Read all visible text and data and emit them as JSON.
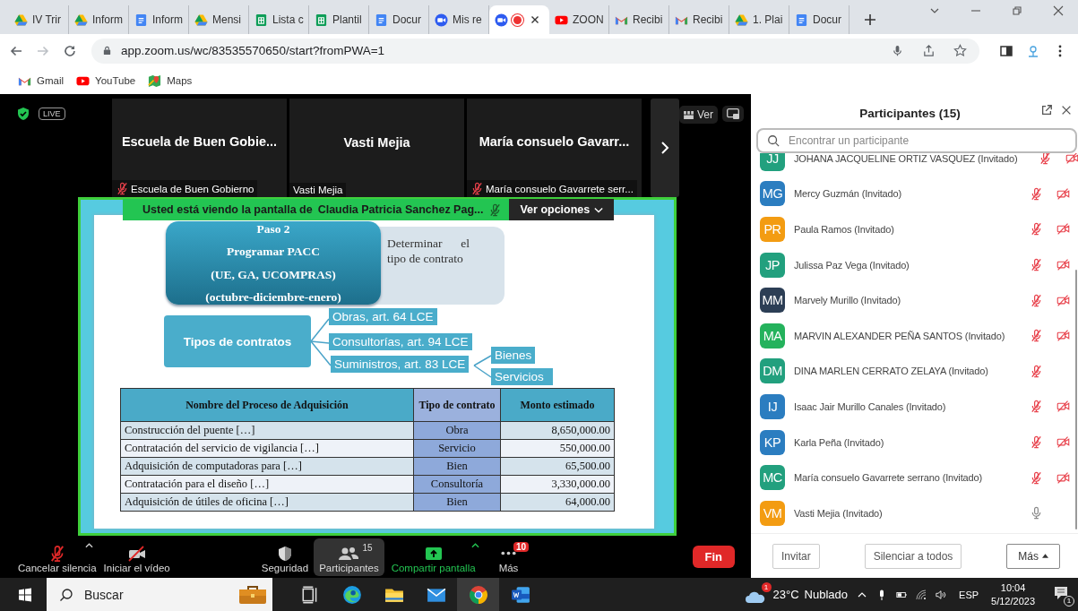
{
  "browser": {
    "tabs": [
      {
        "label": "IV Trir",
        "kind": "drive",
        "selected": false,
        "recording": false
      },
      {
        "label": "Inform",
        "kind": "drive",
        "selected": false,
        "recording": false
      },
      {
        "label": "Inform",
        "kind": "docs",
        "selected": false,
        "recording": false
      },
      {
        "label": "Mensi",
        "kind": "drive",
        "selected": false,
        "recording": false
      },
      {
        "label": "Lista c",
        "kind": "sheets",
        "selected": false,
        "recording": false
      },
      {
        "label": "Plantil",
        "kind": "sheets",
        "selected": false,
        "recording": false
      },
      {
        "label": "Docur",
        "kind": "docs",
        "selected": false,
        "recording": false
      },
      {
        "label": "Mis re",
        "kind": "zoom",
        "selected": false,
        "recording": false
      },
      {
        "kind": "zoom",
        "selected": true,
        "recording": true
      },
      {
        "label": "ZOON",
        "kind": "youtube",
        "selected": false,
        "recording": false
      },
      {
        "label": "Recibi",
        "kind": "gmail",
        "selected": false,
        "recording": false
      },
      {
        "label": "Recibi",
        "kind": "gmail",
        "selected": false,
        "recording": false
      },
      {
        "label": "1. Plai",
        "kind": "drive",
        "selected": false,
        "recording": false
      },
      {
        "label": "Docur",
        "kind": "docs",
        "selected": false,
        "recording": false
      }
    ],
    "url": "app.zoom.us/wc/83535570650/start?fromPWA=1",
    "bookmarks": [
      {
        "label": "Gmail",
        "kind": "gmail"
      },
      {
        "label": "YouTube",
        "kind": "youtube"
      },
      {
        "label": "Maps",
        "kind": "maps"
      }
    ]
  },
  "meeting": {
    "live_label": "LIVE",
    "tiles": [
      {
        "name": "Escuela de Buen Gobie...",
        "label": "Escuela de Buen Gobierno",
        "muted": true
      },
      {
        "name": "Vasti Mejia",
        "label": "Vasti Mejia",
        "muted": false
      },
      {
        "name": "María consuelo Gavarr...",
        "label": "María consuelo Gavarrete serr...",
        "muted": true
      }
    ],
    "view_button": "Ver",
    "banner": {
      "text": "Usted está viendo la pantalla de",
      "presenter": "Claudia Patricia Sanchez Pag...",
      "options": "Ver opciones"
    },
    "slide": {
      "step_lines": [
        "Paso 2",
        "Programar PACC",
        "(UE, GA, UCOMPRAS)",
        "(octubre-diciembre-enero)"
      ],
      "note": "Determinar el tipo de contrato",
      "types_title": "Tipos de contratos",
      "types": [
        {
          "label": "Obras, art. 64 LCE"
        },
        {
          "label": "Consultorías, art. 94 LCE"
        },
        {
          "label": "Suministros, art. 83 LCE",
          "children": [
            {
              "label": "Bienes"
            },
            {
              "label": "Servicios"
            }
          ]
        }
      ],
      "table": {
        "columns": [
          "Nombre del Proceso de Adquisición",
          "Tipo de contrato",
          "Monto estimado"
        ],
        "rows": [
          [
            "Construcción del puente […]",
            "Obra",
            "8,650,000.00"
          ],
          [
            "Contratación del servicio de vigilancia […]",
            "Servicio",
            "550,000.00"
          ],
          [
            "Adquisición de computadoras para […]",
            "Bien",
            "65,500.00"
          ],
          [
            "Contratación para el diseño […]",
            "Consultoría",
            "3,330,000.00"
          ],
          [
            "Adquisición de útiles de oficina […]",
            "Bien",
            "64,000.00"
          ]
        ]
      }
    },
    "toolbar": [
      {
        "kind": "mic",
        "label": "Cancelar silencia",
        "caret": true,
        "selected": false
      },
      {
        "kind": "video",
        "label": "Iniciar el vídeo",
        "caret": false,
        "selected": false
      },
      {
        "kind": "security",
        "label": "Seguridad",
        "caret": false,
        "selected": false
      },
      {
        "kind": "participants",
        "label": "Participantes",
        "badge": "15",
        "caret": false,
        "selected": true
      },
      {
        "kind": "share",
        "label": "Compartir pantalla",
        "caret": true,
        "selected": false
      },
      {
        "kind": "more",
        "label": "Más",
        "badge": "10",
        "caret": false,
        "selected": false
      }
    ],
    "end_button": "Fin"
  },
  "participants_panel": {
    "title": "Participantes (15)",
    "search_placeholder": "Encontrar un participante",
    "participants": [
      {
        "initials": "JJ",
        "name": "JOHANA JACQUELINE ORTIZ VASQUEZ (Invitado)",
        "color": "#22a07e",
        "mic_muted": true,
        "video_off": true
      },
      {
        "initials": "MG",
        "name": "Mercy Guzmán (Invitado)",
        "color": "#2b7dc0",
        "mic_muted": true,
        "video_off": true
      },
      {
        "initials": "PR",
        "name": "Paula Ramos (Invitado)",
        "color": "#f39c12",
        "mic_muted": true,
        "video_off": true
      },
      {
        "initials": "JP",
        "name": "Julissa Paz Vega (Invitado)",
        "color": "#22a07e",
        "mic_muted": true,
        "video_off": true
      },
      {
        "initials": "MM",
        "name": "Marvely Murillo (Invitado)",
        "color": "#2c3e55",
        "mic_muted": true,
        "video_off": true
      },
      {
        "initials": "MA",
        "name": "MARVIN ALEXANDER PEÑA SANTOS (Invitado)",
        "color": "#24b25c",
        "mic_muted": true,
        "video_off": true
      },
      {
        "initials": "DM",
        "name": "DINA MARLEN CERRATO ZELAYA (Invitado)",
        "color": "#22a07e",
        "mic_muted": true,
        "video_off": false
      },
      {
        "initials": "IJ",
        "name": "Isaac Jair Murillo Canales (Invitado)",
        "color": "#2b7dc0",
        "mic_muted": true,
        "video_off": true
      },
      {
        "initials": "KP",
        "name": "Karla Peña (Invitado)",
        "color": "#2b7dc0",
        "mic_muted": true,
        "video_off": true
      },
      {
        "initials": "MC",
        "name": "María consuelo Gavarrete serrano (Invitado)",
        "color": "#22a07e",
        "mic_muted": true,
        "video_off": true
      },
      {
        "initials": "VM",
        "name": "Vasti Mejia (Invitado)",
        "color": "#f39c12",
        "mic_muted": false,
        "video_off": false
      }
    ],
    "buttons": [
      {
        "label": "Invitar",
        "kind": "plain"
      },
      {
        "label": "Silenciar a todos",
        "kind": "plain"
      },
      {
        "label": "Más",
        "kind": "menu"
      }
    ]
  },
  "taskbar": {
    "search_placeholder": "Buscar",
    "apps": [
      {
        "kind": "task-view",
        "selected": false
      },
      {
        "kind": "edge",
        "selected": false
      },
      {
        "kind": "explorer",
        "selected": false
      },
      {
        "kind": "mail",
        "selected": false
      },
      {
        "kind": "chrome",
        "selected": true
      },
      {
        "kind": "word",
        "selected": false
      }
    ],
    "weather_badge": "1",
    "temperature": "23°C",
    "condition": "Nublado",
    "language": "ESP",
    "time": "10:04",
    "date": "5/12/2023",
    "notifications": "1"
  }
}
